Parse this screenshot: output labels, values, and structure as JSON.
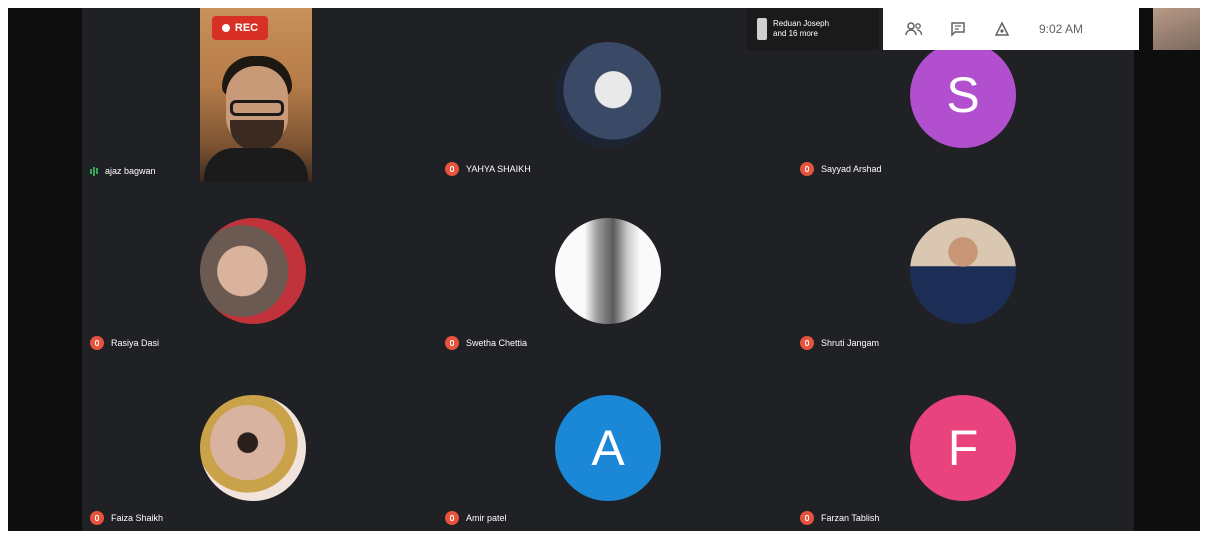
{
  "recording": {
    "label": "REC"
  },
  "notification": {
    "line1": "Reduan Joseph",
    "line2": "and 16 more"
  },
  "clock": {
    "time": "9:02 AM"
  },
  "participants": [
    {
      "name": "ajaz bagwan",
      "type": "video"
    },
    {
      "name": "YAHYA SHAIKH",
      "type": "photo"
    },
    {
      "name": "Sayyad Arshad",
      "type": "letter",
      "letter": "S",
      "color": "#b14fcf"
    },
    {
      "name": "Rasiya Dasi",
      "type": "photo"
    },
    {
      "name": "Swetha Chettia",
      "type": "photo"
    },
    {
      "name": "Shruti Jangam",
      "type": "photo"
    },
    {
      "name": "Faiza Shaikh",
      "type": "photo"
    },
    {
      "name": "Amir patel",
      "type": "letter",
      "letter": "A",
      "color": "#1a88d6"
    },
    {
      "name": "Farzan Tablish",
      "type": "letter",
      "letter": "F",
      "color": "#e8437c"
    }
  ],
  "colors": {
    "stage": "#202124",
    "muted": "#e8533d",
    "speaking": "#34a853"
  },
  "icons": [
    "people-icon",
    "chat-icon",
    "activities-icon"
  ]
}
